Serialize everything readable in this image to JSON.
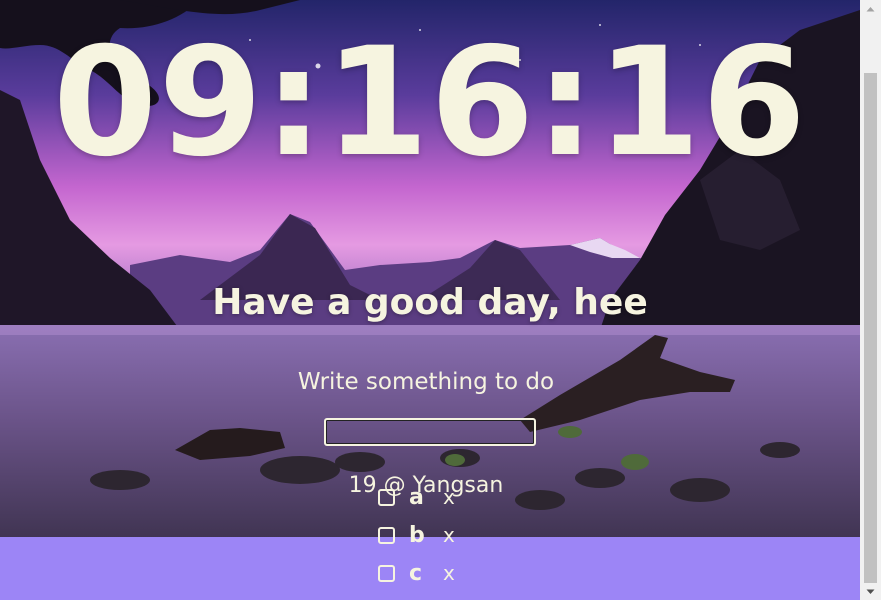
{
  "clock": {
    "time": "09:16:16"
  },
  "greeting": {
    "text": "Have a good day, hee"
  },
  "todo_form": {
    "prompt": "Write something to do",
    "input_value": ""
  },
  "weather": {
    "text": "19 @ Yangsan"
  },
  "todos": [
    {
      "label": "a",
      "delete": "x"
    },
    {
      "label": "b",
      "delete": "x"
    },
    {
      "label": "c",
      "delete": "x"
    }
  ],
  "colors": {
    "text": "#f6f4e0",
    "footer": "#9c85f6",
    "sky_top": "#2a2a78",
    "sky_mid": "#c56ad6",
    "water": "#5a4470"
  },
  "icons": {
    "scroll_up": "arrow-up-icon",
    "scroll_down": "arrow-down-icon"
  }
}
